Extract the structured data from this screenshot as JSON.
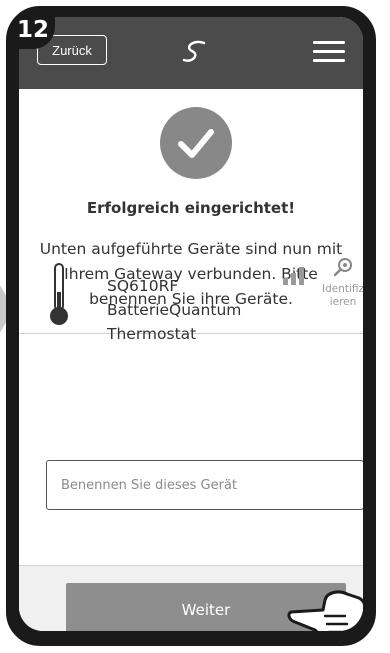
{
  "step": {
    "number": "12"
  },
  "header": {
    "back_label": "Zurück",
    "logo_icon": "swirl-logo-icon",
    "menu_icon": "hamburger-menu-icon"
  },
  "status": {
    "icon": "checkmark-icon",
    "title": "Erfolgreich eingerichtet!",
    "description": "Unten aufgeführte Geräte sind nun mit Ihrem Gateway verbunden. Bitte benennen Sie ihre Geräte."
  },
  "device": {
    "icon": "thermometer-icon",
    "model": "SQ610RF",
    "line2": "BatterieQuantum",
    "line3": "Thermostat",
    "signal_icon": "signal-strength-icon",
    "identify_icon": "identify-search-icon",
    "identify_label_1": "Identifiz",
    "identify_label_2": "ieren"
  },
  "name_field": {
    "placeholder": "Benennen Sie dieses Gerät",
    "value": ""
  },
  "footer": {
    "next_label": "Weiter",
    "pointer_icon": "pointing-hand-icon"
  },
  "colors": {
    "header_bg": "#4b4b4b",
    "check_bg": "#888888",
    "button_bg": "#8e8e8e"
  }
}
